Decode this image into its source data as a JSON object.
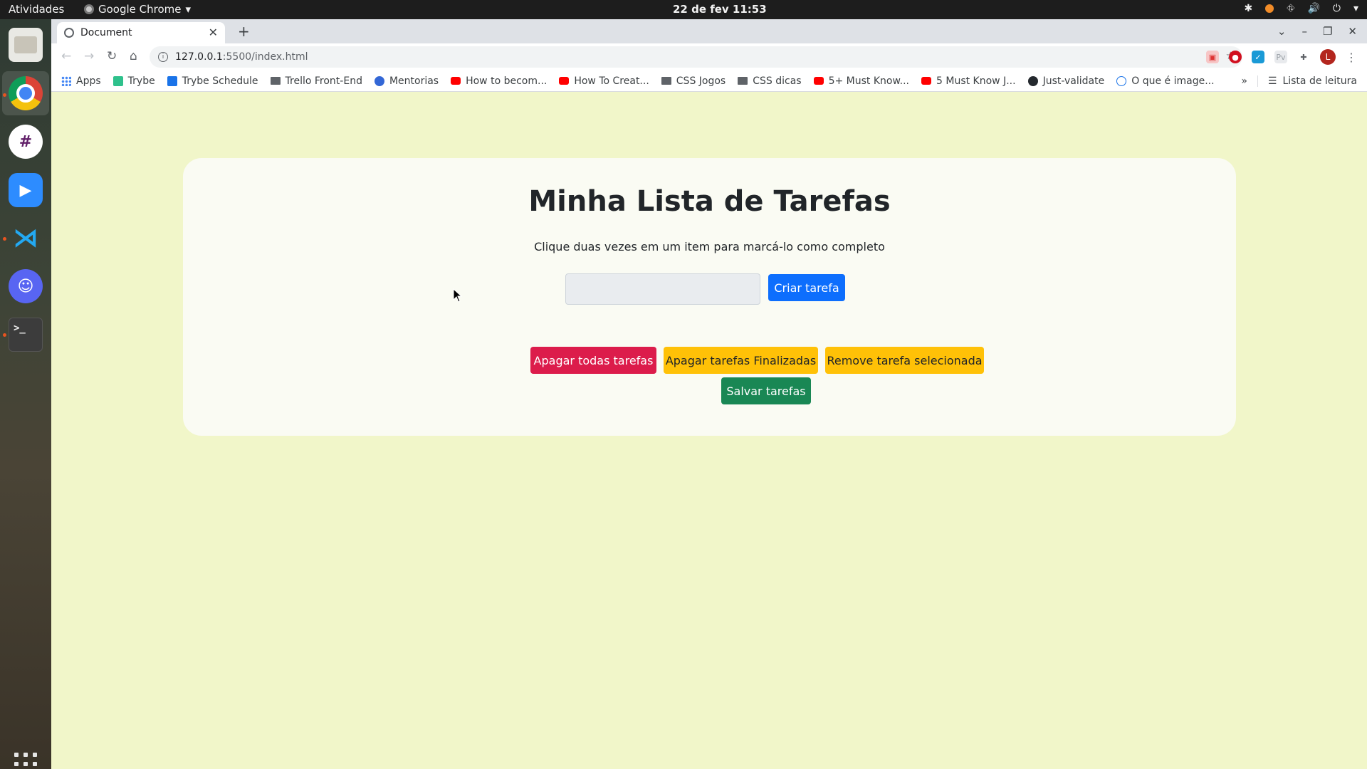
{
  "topbar": {
    "activities": "Atividades",
    "app_name": "Google Chrome",
    "clock": "22 de fev  11:53"
  },
  "dock": {
    "items": [
      "files-icon",
      "chrome-icon",
      "slack-icon",
      "zoom-icon",
      "vscode-icon",
      "discord-icon",
      "terminal-icon"
    ],
    "apps_grid": "show-applications-icon"
  },
  "browser": {
    "tab_title": "Document",
    "url_host": "127.0.0.1",
    "url_path": ":5500/index.html",
    "avatar_letter": "L",
    "bookmarks": [
      {
        "label": "Apps",
        "icon": "apps"
      },
      {
        "label": "Trybe",
        "icon": "trybe"
      },
      {
        "label": "Trybe Schedule",
        "icon": "sched"
      },
      {
        "label": "Trello Front-End",
        "icon": "folder"
      },
      {
        "label": "Mentorias",
        "icon": "ment"
      },
      {
        "label": "How to becom...",
        "icon": "yt"
      },
      {
        "label": "How To Creat...",
        "icon": "yt"
      },
      {
        "label": "CSS Jogos",
        "icon": "folder"
      },
      {
        "label": "CSS dicas",
        "icon": "folder"
      },
      {
        "label": "5+ Must Know...",
        "icon": "yt"
      },
      {
        "label": "5 Must Know J...",
        "icon": "yt"
      },
      {
        "label": "Just-validate",
        "icon": "gh"
      },
      {
        "label": "O que é image...",
        "icon": "page"
      }
    ],
    "bookmarks_more": "»",
    "reading_list": "Lista de leitura"
  },
  "page": {
    "title": "Minha Lista de Tarefas",
    "instructions": "Clique duas vezes em um item para marcá-lo como completo",
    "task_input_value": "",
    "create_button": "Criar tarefa",
    "clear_all_button": "Apagar todas tarefas",
    "clear_done_button": "Apagar tarefas Finalizadas",
    "remove_selected_button": "Remove tarefa selecionada",
    "save_button": "Salvar tarefas"
  },
  "colors": {
    "page_background": "#f1f6c9",
    "card_background": "#fafbf3",
    "primary": "#0d6efd",
    "danger": "#dc1c4b",
    "warning": "#ffc107",
    "success": "#198754"
  }
}
